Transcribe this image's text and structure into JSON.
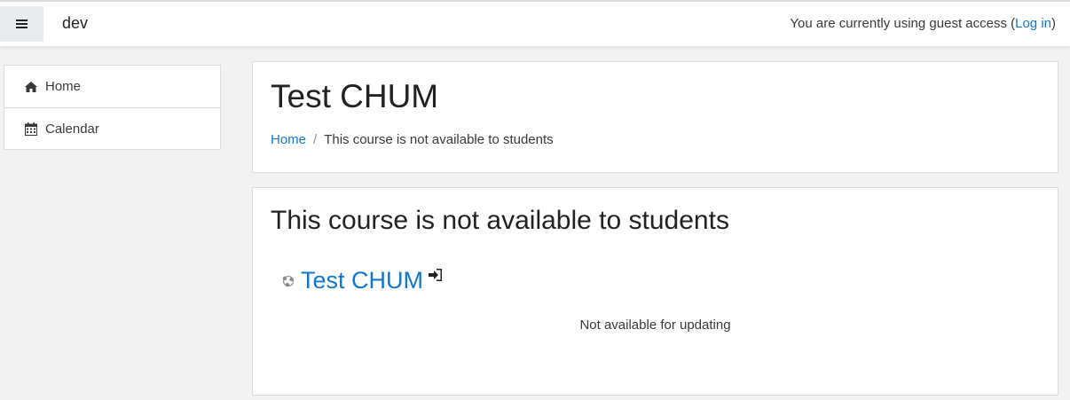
{
  "navbar": {
    "brand": "dev",
    "login_prefix": "You are currently using guest access (",
    "login_link": "Log in",
    "login_suffix": ")"
  },
  "sidebar": {
    "items": [
      {
        "label": "Home",
        "icon": "home-icon"
      },
      {
        "label": "Calendar",
        "icon": "calendar-icon"
      }
    ]
  },
  "header": {
    "title": "Test CHUM",
    "breadcrumb": {
      "home": "Home",
      "separator": "/",
      "current": "This course is not available to students"
    }
  },
  "content": {
    "title": "This course is not available to students",
    "course_name": "Test CHUM",
    "status": "Not available for updating"
  },
  "colors": {
    "link": "#1177d1",
    "text": "#373a3c",
    "background": "#f2f2f2"
  }
}
